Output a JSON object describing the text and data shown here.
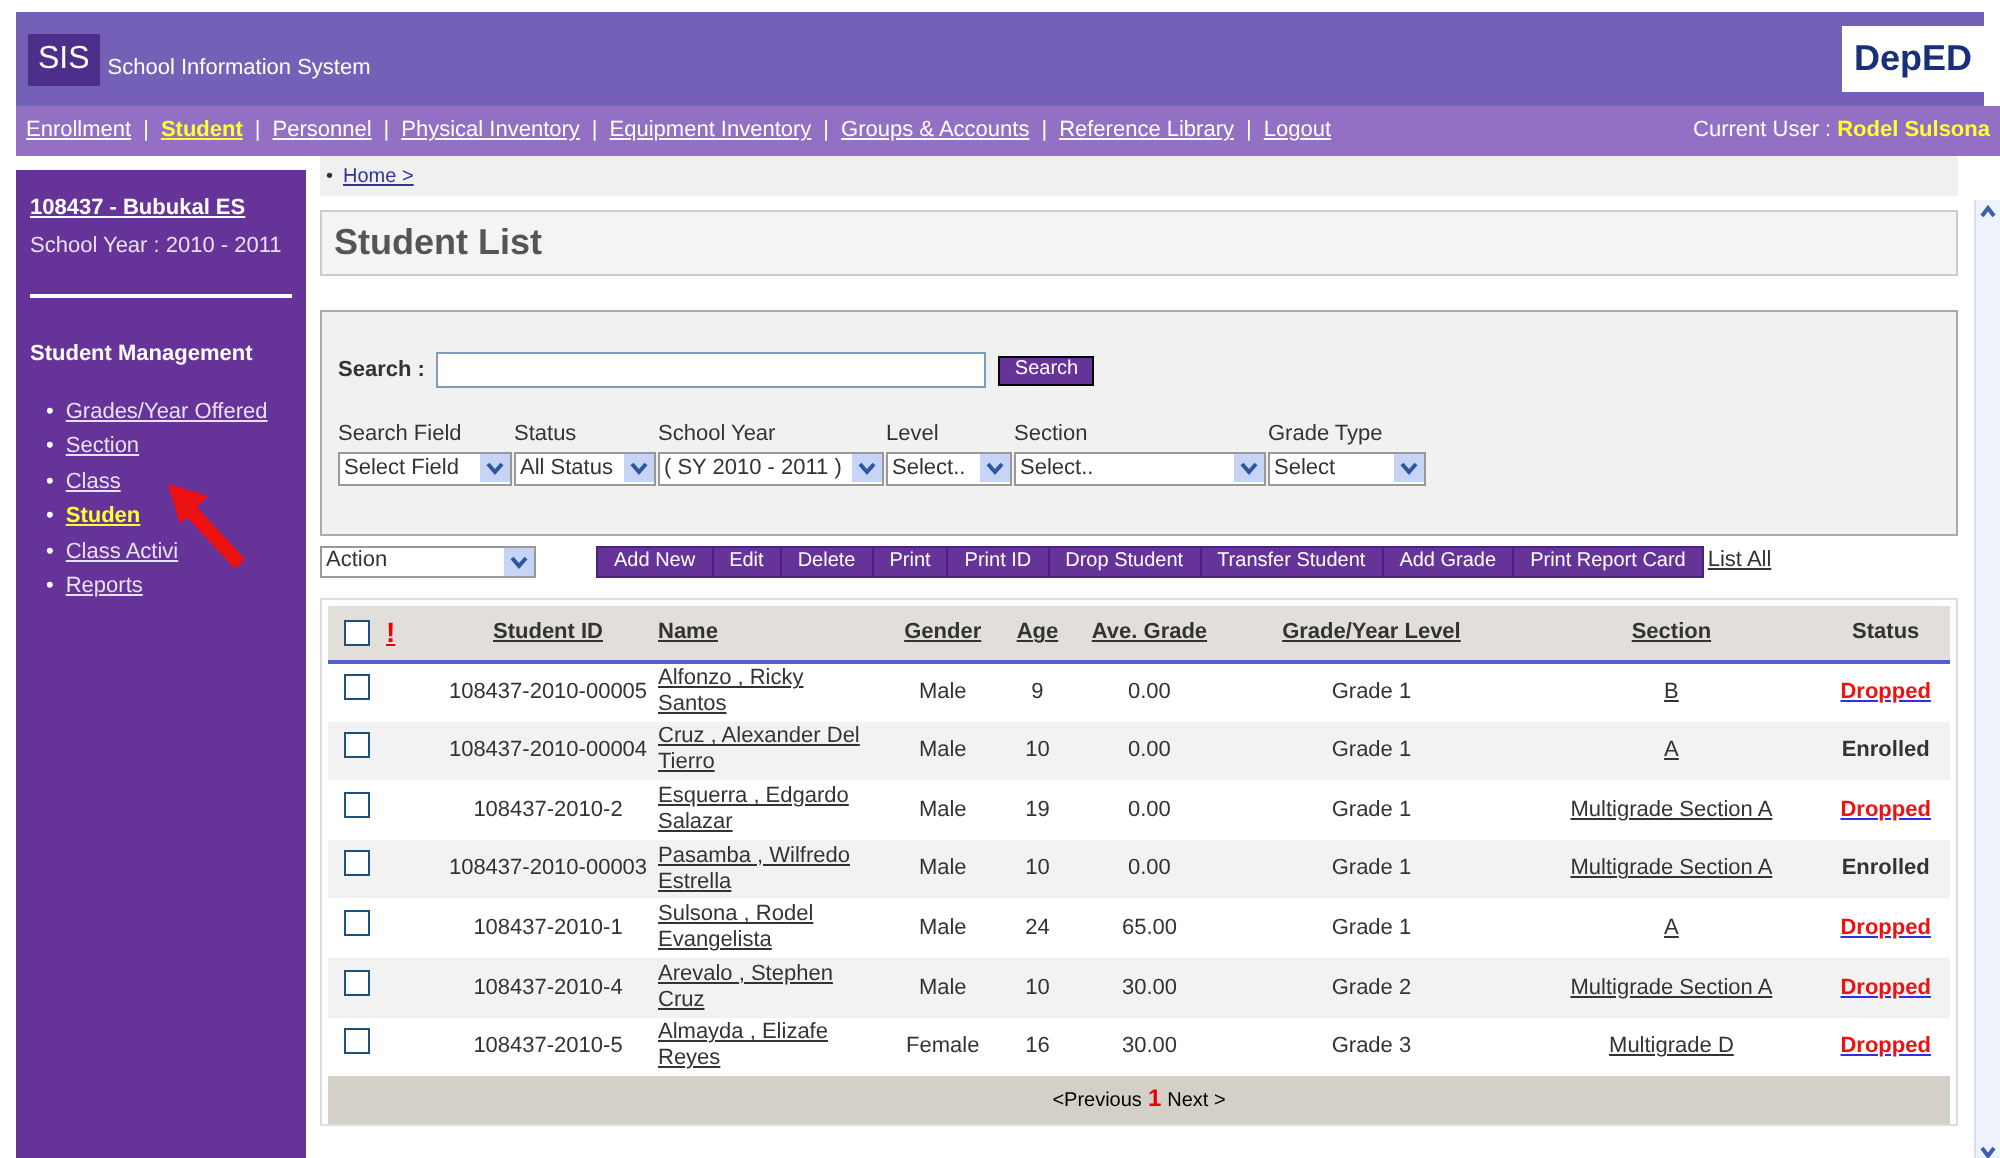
{
  "header": {
    "logo": "SIS",
    "title": "School Information System",
    "badge": "DepED"
  },
  "nav": {
    "items": [
      {
        "label": "Enrollment",
        "selected": false
      },
      {
        "label": "Student",
        "selected": true
      },
      {
        "label": "Personnel",
        "selected": false
      },
      {
        "label": "Physical Inventory",
        "selected": false
      },
      {
        "label": "Equipment Inventory",
        "selected": false
      },
      {
        "label": "Groups & Accounts",
        "selected": false
      },
      {
        "label": "Reference Library",
        "selected": false
      },
      {
        "label": "Logout",
        "selected": false
      }
    ],
    "separator": "|",
    "user_label": "Current User :",
    "user": "Rodel Sulsona"
  },
  "sidebar": {
    "school": "108437 - Bubukal ES",
    "school_year": "School Year : 2010 - 2011",
    "heading": "Student Management",
    "bullet": "•",
    "items": [
      {
        "label": "Grades/Year Offered",
        "selected": false
      },
      {
        "label": "Section",
        "selected": false
      },
      {
        "label": "Class",
        "selected": false
      },
      {
        "label": "Studen",
        "selected": true
      },
      {
        "label": "Class Activi",
        "selected": false
      },
      {
        "label": "Reports",
        "selected": false
      }
    ]
  },
  "breadcrumb_bullet": "•",
  "breadcrumb": "Home >",
  "page_title": "Student List",
  "search": {
    "label": "Search :",
    "button": "Search"
  },
  "filters": [
    {
      "label": "Search Field",
      "value": "Select Field"
    },
    {
      "label": "Status",
      "value": "All Status"
    },
    {
      "label": "School Year",
      "value": "( SY 2010 - 2011 )"
    },
    {
      "label": "Level",
      "value": "Select.."
    },
    {
      "label": "Section",
      "value": "Select.."
    },
    {
      "label": "Grade Type",
      "value": "Select"
    }
  ],
  "action_select": "Action",
  "actions": [
    "Add New",
    "Edit",
    "Delete",
    "Print",
    "Print ID",
    "Drop Student",
    "Transfer Student",
    "Add Grade",
    "Print Report Card"
  ],
  "list_all": "List All",
  "table": {
    "select_all_checked": false,
    "flag": "!",
    "columns": [
      "Student ID",
      "Name",
      "Gender",
      "Age",
      "Ave. Grade",
      "Grade/Year Level",
      "Section",
      "Status"
    ],
    "rows": [
      {
        "checked": false,
        "id": "108437-2010-00005",
        "name": "Alfonzo , Ricky Santos",
        "gender": "Male",
        "age": "9",
        "grade": "0.00",
        "level": "Grade 1",
        "section": "B",
        "status": "Dropped",
        "dropped": true
      },
      {
        "checked": false,
        "id": "108437-2010-00004",
        "name": "Cruz , Alexander Del Tierro",
        "gender": "Male",
        "age": "10",
        "grade": "0.00",
        "level": "Grade 1",
        "section": "A",
        "status": "Enrolled",
        "dropped": false
      },
      {
        "checked": false,
        "id": "108437-2010-2",
        "name": "Esquerra , Edgardo Salazar",
        "gender": "Male",
        "age": "19",
        "grade": "0.00",
        "level": "Grade 1",
        "section": "Multigrade Section A",
        "status": "Dropped",
        "dropped": true
      },
      {
        "checked": false,
        "id": "108437-2010-00003",
        "name": "Pasamba , Wilfredo Estrella",
        "gender": "Male",
        "age": "10",
        "grade": "0.00",
        "level": "Grade 1",
        "section": "Multigrade Section A",
        "status": "Enrolled",
        "dropped": false
      },
      {
        "checked": false,
        "id": "108437-2010-1",
        "name": "Sulsona , Rodel Evangelista",
        "gender": "Male",
        "age": "24",
        "grade": "65.00",
        "level": "Grade 1",
        "section": "A",
        "status": "Dropped",
        "dropped": true
      },
      {
        "checked": false,
        "id": "108437-2010-4",
        "name": "Arevalo , Stephen Cruz",
        "gender": "Male",
        "age": "10",
        "grade": "30.00",
        "level": "Grade 2",
        "section": "Multigrade Section A",
        "status": "Dropped",
        "dropped": true
      },
      {
        "checked": false,
        "id": "108437-2010-5",
        "name": "Almayda , Elizafe Reyes",
        "gender": "Female",
        "age": "16",
        "grade": "30.00",
        "level": "Grade 3",
        "section": "Multigrade D",
        "status": "Dropped",
        "dropped": true
      }
    ]
  },
  "pager": {
    "previous": "<Previous",
    "page": "1",
    "next": "Next >"
  }
}
